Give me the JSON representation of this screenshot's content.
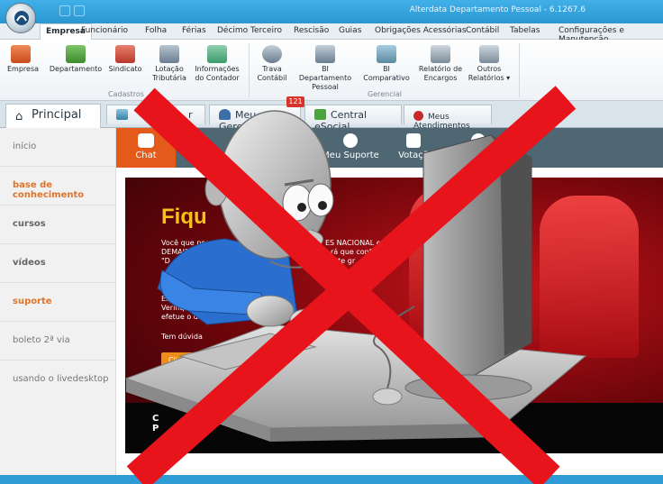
{
  "window": {
    "title": "Alterdata Departamento Pessoal - 6.1267.6"
  },
  "menu": [
    {
      "label": "Empresa",
      "active": true
    },
    {
      "label": "Funcionário"
    },
    {
      "label": "Folha"
    },
    {
      "label": "Férias"
    },
    {
      "label": "Décimo Terceiro"
    },
    {
      "label": "Rescisão"
    },
    {
      "label": "Guias"
    },
    {
      "label": "Obrigações Acessórias"
    },
    {
      "label": "Contábil"
    },
    {
      "label": "Tabelas"
    },
    {
      "label": "Configurações e Manutenção"
    }
  ],
  "ribbon": {
    "buttons": [
      {
        "label": "Empresa",
        "icon": "building-add-icon",
        "color": "#e05a2a"
      },
      {
        "label": "Departamento",
        "icon": "department-icon",
        "color": "#4a9a3a"
      },
      {
        "label": "Sindicato",
        "icon": "union-people-icon",
        "color": "#d04a3a"
      },
      {
        "label": "Lotação Tributária",
        "icon": "tax-allocation-icon",
        "color": "#6a7d90"
      },
      {
        "label": "Informações do Contador",
        "icon": "accountant-info-icon",
        "color": "#3a9a6a"
      },
      {
        "label": "Trava Contábil",
        "icon": "lock-icon",
        "color": "#6a7d90"
      },
      {
        "label": "BI Departamento Pessoal",
        "icon": "bi-department-icon",
        "color": "#6a7d90"
      },
      {
        "label": "BI Comparativo",
        "icon": "bi-compare-icon",
        "color": "#5a8aa0"
      },
      {
        "label": "Relatório de Encargos",
        "icon": "charges-report-icon",
        "color": "#6a7d90"
      },
      {
        "label": "Outros Relatórios ▾",
        "icon": "other-reports-icon",
        "color": "#6a7d90"
      }
    ],
    "groups": [
      {
        "label": "Cadastros"
      },
      {
        "label": "Gerencial"
      }
    ]
  },
  "tabs": [
    {
      "label": "Principal",
      "icon": "home-icon",
      "active": true
    },
    {
      "label": "r",
      "icon": "chart-icon"
    },
    {
      "label": "Meu Gerente",
      "icon": "user-icon"
    },
    {
      "label": "Central eSocial",
      "icon": "esocial-icon"
    },
    {
      "label": "Meus Atendimentos",
      "icon": "support-icon"
    }
  ],
  "tab_badge": "121",
  "sidebar": [
    {
      "label": "início",
      "style": "normal"
    },
    {
      "label": "base de conhecimento",
      "style": "orange"
    },
    {
      "label": "cursos",
      "style": "bold"
    },
    {
      "label": "vídeos",
      "style": "bold"
    },
    {
      "label": "suporte",
      "style": "orange"
    },
    {
      "label": "boleto 2ª via",
      "style": "normal"
    },
    {
      "label": "usando o livedesktop",
      "style": "normal"
    }
  ],
  "greybar": [
    {
      "label": "Chat",
      "icon": "chat-icon",
      "active": true
    },
    {
      "label": "Meu Suporte",
      "icon": "headset-icon"
    },
    {
      "label": "Votaçã",
      "icon": "vote-icon"
    },
    {
      "label": "as",
      "icon": "info-icon"
    }
  ],
  "banner": {
    "heading": "Fiqu",
    "lines": [
      "Você que possui emp",
      "ES NACIONAL e",
      "DEMAIS) ANTE",
      "rá que confo",
      "\"D",
      "ste gr"
    ],
    "lines2": [
      "Empresa",
      "Verifique se a",
      "efetue o devi"
    ],
    "ask": "Tem dúvida",
    "cta": "Clique a",
    "footer": "C\nP"
  },
  "colors": {
    "window_blue": "#2f9bd6",
    "accent_orange": "#e35a1a",
    "banner_red": "#c8141a",
    "cross_red": "#e8141c"
  }
}
